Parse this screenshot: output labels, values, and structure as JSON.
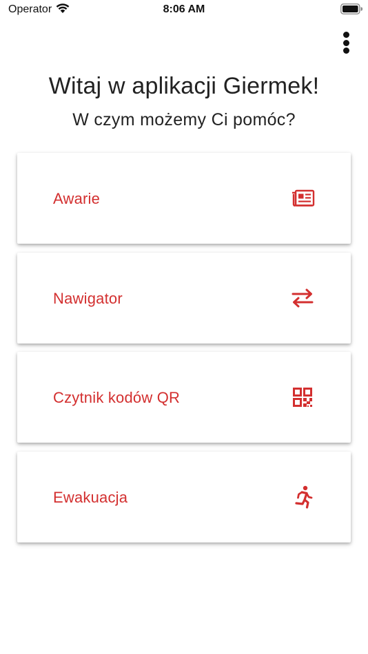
{
  "status_bar": {
    "carrier": "Operator",
    "time": "8:06 AM",
    "wifi_icon": "wifi-icon",
    "battery_icon": "battery-icon"
  },
  "toolbar": {
    "menu_icon": "more-vert-icon"
  },
  "header": {
    "title": "Witaj w aplikacji Giermek!",
    "subtitle": "W czym możemy Ci pomóc?"
  },
  "menu": {
    "items": [
      {
        "label": "Awarie",
        "icon": "newspaper-icon"
      },
      {
        "label": "Nawigator",
        "icon": "swap-arrows-icon"
      },
      {
        "label": "Czytnik kodów QR",
        "icon": "qr-code-icon"
      },
      {
        "label": "Ewakuacja",
        "icon": "running-person-icon"
      }
    ]
  },
  "colors": {
    "accent": "#d32f2f",
    "text": "#222222",
    "background": "#ffffff"
  }
}
